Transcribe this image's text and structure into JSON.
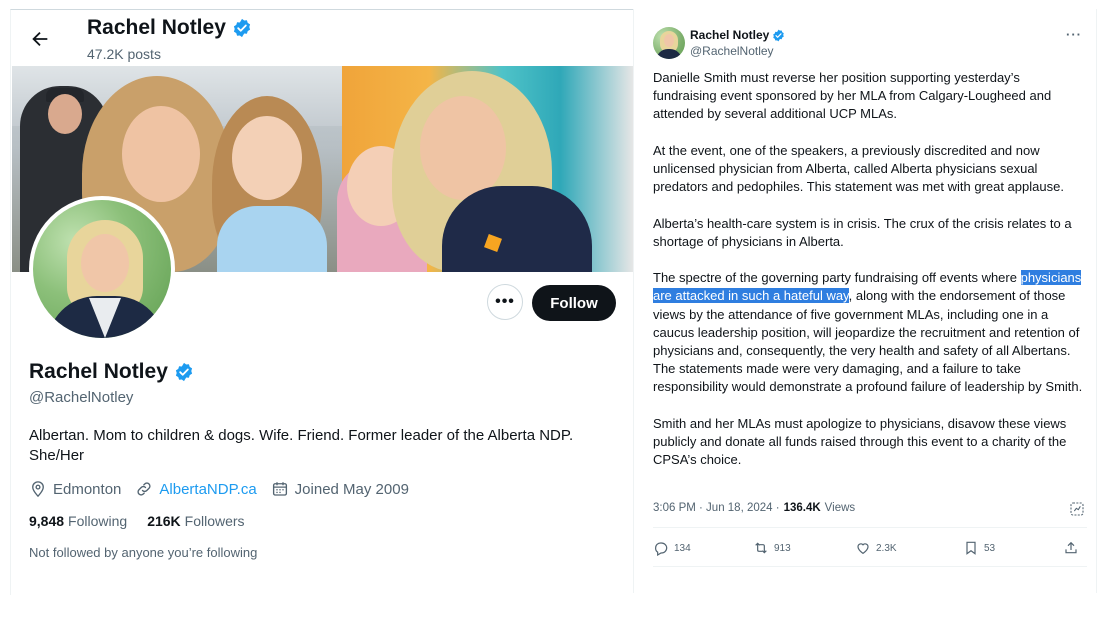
{
  "profile": {
    "name": "Rachel Notley",
    "posts": "47.2K posts",
    "handle": "@RachelNotley",
    "bio": "Albertan. Mom to children & dogs. Wife. Friend. Former leader of the Alberta NDP. She/Her",
    "location": "Edmonton",
    "website": "AlbertaNDP.ca",
    "joined": "Joined May 2009",
    "following_count": "9,848",
    "following_label": "Following",
    "followers_count": "216K",
    "followers_label": "Followers",
    "not_followed": "Not followed by anyone you’re following",
    "follow_button": "Follow",
    "more_button": "•••"
  },
  "tweet": {
    "name": "Rachel Notley",
    "handle": "@RachelNotley",
    "more": "···",
    "p1": "Danielle Smith must reverse her position supporting yesterday’s fundraising event sponsored by her MLA from Calgary-Lougheed and attended by several additional UCP MLAs.",
    "p2": "At the event, one of the speakers, a previously discredited and now unlicensed physician from Alberta, called Alberta physicians sexual predators and pedophiles. This statement was met with great applause.",
    "p3": "Alberta’s health-care system is in crisis. The crux of the crisis relates to a shortage of physicians in Alberta.",
    "p4_before": "The spectre of the governing party fundraising off events where ",
    "p4_highlight": "physicians are attacked in such a hateful way",
    "p4_after": ", along with the endorsement of those views by the attendance of five government MLAs, including one in a caucus leadership position, will jeopardize the recruitment and retention of physicians and, consequently, the very health and safety of all Albertans. The statements made were very damaging, and a failure to take responsibility would demonstrate a profound failure of leadership by Smith.",
    "p5": "Smith and her MLAs must apologize to physicians, disavow these views publicly and donate all funds raised through this event to a charity of the CPSA’s choice.",
    "time": "3:06 PM · Jun 18, 2024 ·",
    "views_count": "136.4K",
    "views_label": "Views",
    "replies": "134",
    "reposts": "913",
    "likes": "2.3K",
    "bookmarks": "53"
  },
  "colors": {
    "accent": "#1d9bf0",
    "text": "#0f1419",
    "muted": "#536471",
    "highlight": "#2f7ee0",
    "follow_bg": "#0f1419"
  }
}
